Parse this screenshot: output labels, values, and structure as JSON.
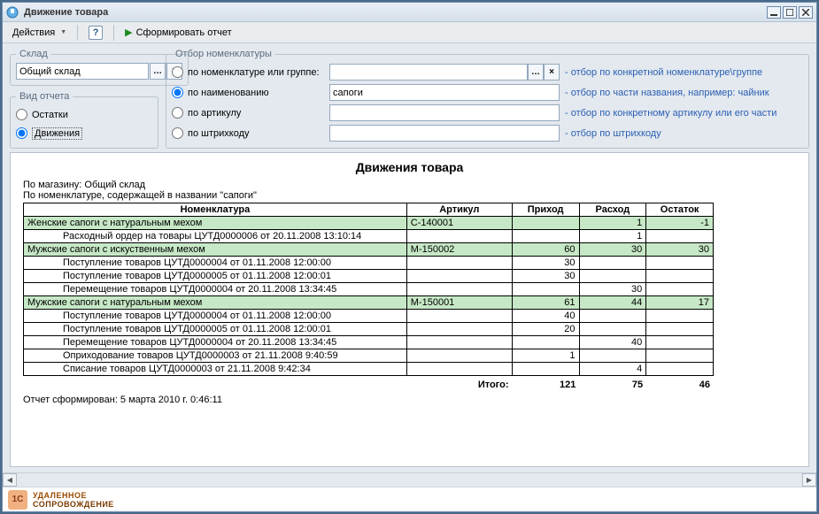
{
  "window": {
    "title": "Движение товара"
  },
  "toolbar": {
    "actions_label": "Действия",
    "help_tooltip": "?",
    "run_label": "Сформировать отчет"
  },
  "groups": {
    "sklad": "Склад",
    "vid": "Вид отчета",
    "otbor": "Отбор номенклатуры"
  },
  "sklad": {
    "value": "Общий склад"
  },
  "vid": {
    "ostatki": "Остатки",
    "dvizh": "Движения",
    "selected": "dvizh"
  },
  "otbor": {
    "by_nomk": "по номенклатуре или группе:",
    "by_name": "по наименованию",
    "by_art": "по артикулу",
    "by_barcode": "по штрихкоду",
    "selected": "by_name",
    "name_value": "сапоги",
    "nomk_value": "",
    "art_value": "",
    "barcode_value": "",
    "hints": {
      "nomk": "- отбор по конкретной номенклатуре\\группе",
      "name": "- отбор по части названия, например: чайник",
      "art": "- отбор по конкретному артикулу или его части",
      "barcode": "- отбор по штрихкоду"
    }
  },
  "report": {
    "title": "Движения товара",
    "line1": "По магазину: Общий склад",
    "line2": "По номенклатуре, содержащей в названии \"сапоги\"",
    "columns": {
      "nom": "Номенклатура",
      "art": "Артикул",
      "in": "Приход",
      "out": "Расход",
      "rest": "Остаток"
    },
    "groups": [
      {
        "name": "Женские сапоги с натуральным мехом",
        "art": "С-140001",
        "in": "",
        "out": "1",
        "rest": "-1",
        "rows": [
          {
            "name": "Расходный ордер на товары ЦУТД0000006 от 20.11.2008 13:10:14",
            "in": "",
            "out": "1",
            "rest": ""
          }
        ]
      },
      {
        "name": "Мужские сапоги с искуственным мехом",
        "art": "М-150002",
        "in": "60",
        "out": "30",
        "rest": "30",
        "rows": [
          {
            "name": "Поступление товаров ЦУТД0000004 от 01.11.2008 12:00:00",
            "in": "30",
            "out": "",
            "rest": ""
          },
          {
            "name": "Поступление товаров ЦУТД0000005 от 01.11.2008 12:00:01",
            "in": "30",
            "out": "",
            "rest": ""
          },
          {
            "name": "Перемещение товаров ЦУТД0000004 от 20.11.2008 13:34:45",
            "in": "",
            "out": "30",
            "rest": ""
          }
        ]
      },
      {
        "name": "Мужские сапоги с натуральным мехом",
        "art": "М-150001",
        "in": "61",
        "out": "44",
        "rest": "17",
        "rows": [
          {
            "name": "Поступление товаров ЦУТД0000004 от 01.11.2008 12:00:00",
            "in": "40",
            "out": "",
            "rest": ""
          },
          {
            "name": "Поступление товаров ЦУТД0000005 от 01.11.2008 12:00:01",
            "in": "20",
            "out": "",
            "rest": ""
          },
          {
            "name": "Перемещение товаров ЦУТД0000004 от 20.11.2008 13:34:45",
            "in": "",
            "out": "40",
            "rest": ""
          },
          {
            "name": "Оприходование товаров ЦУТД0000003 от 21.11.2008 9:40:59",
            "in": "1",
            "out": "",
            "rest": ""
          },
          {
            "name": "Списание товаров ЦУТД0000003 от 21.11.2008 9:42:34",
            "in": "",
            "out": "4",
            "rest": ""
          }
        ]
      }
    ],
    "total": {
      "label": "Итого:",
      "in": "121",
      "out": "75",
      "rest": "46"
    },
    "timestamp": "Отчет сформирован: 5 марта 2010 г. 0:46:11"
  },
  "footer": {
    "line1": "УДАЛЕННОЕ",
    "line2": "СОПРОВОЖДЕНИЕ",
    "badge": "1C"
  }
}
